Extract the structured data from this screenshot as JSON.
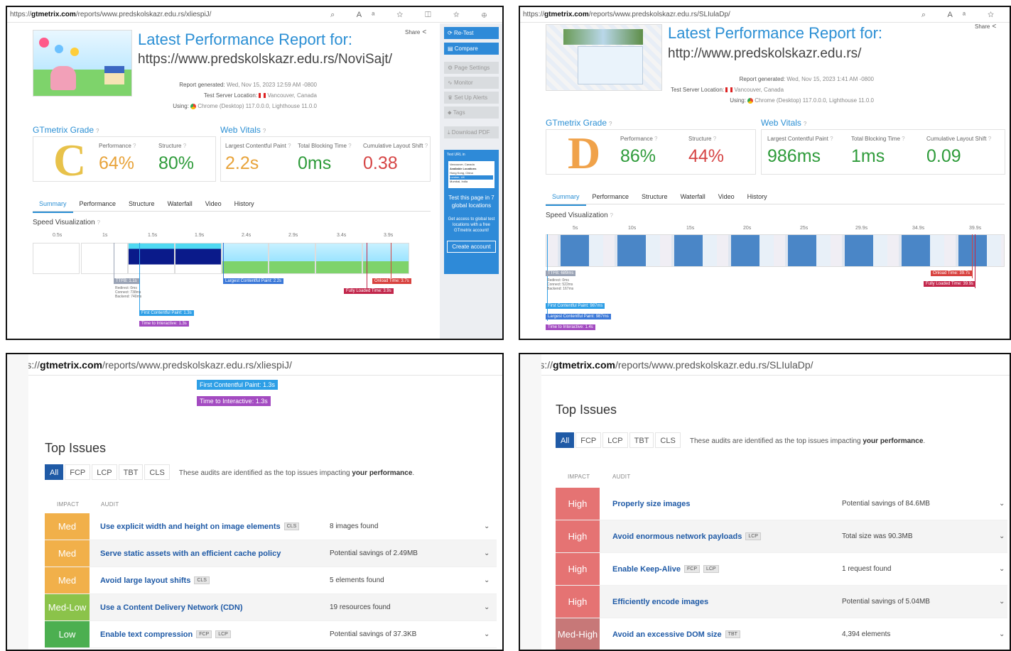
{
  "colors": {
    "accent": "#2b8fd4",
    "med": "#f1b04a",
    "medlow": "#8bc34a",
    "low": "#4caf50",
    "high": "#e57373",
    "medhigh": "#c77878"
  },
  "p1": {
    "url_prefix": "https://",
    "url_domain": "gtmetrix.com",
    "url_path": "/reports/www.predskolskazr.edu.rs/xliespiJ/",
    "title": "Latest Performance Report for:",
    "report_url": "https://www.predskolskazr.edu.rs/NoviSajt/",
    "share": "Share",
    "meta": {
      "generated_label": "Report generated:",
      "generated": "Wed, Nov 15, 2023 12:59 AM -0800",
      "location_label": "Test Server Location:",
      "location": "Vancouver, Canada",
      "using_label": "Using:",
      "using": "Chrome (Desktop) 117.0.0.0, Lighthouse 11.0.0"
    },
    "grade_label": "GTmetrix Grade",
    "vitals_label": "Web Vitals",
    "grade": "C",
    "performance_label": "Performance",
    "performance": "64%",
    "structure_label": "Structure",
    "structure": "80%",
    "lcp_label": "Largest Contentful Paint",
    "lcp": "2.2s",
    "tbt_label": "Total Blocking Time",
    "tbt": "0ms",
    "cls_label": "Cumulative Layout Shift",
    "cls": "0.38",
    "tabs": [
      "Summary",
      "Performance",
      "Structure",
      "Waterfall",
      "Video",
      "History"
    ],
    "speed_label": "Speed Visualization",
    "ticks": [
      "0.5s",
      "1s",
      "1.5s",
      "1.9s",
      "2.4s",
      "2.9s",
      "3.4s",
      "3.9s"
    ],
    "ttfb": "TTFB: 1.1s",
    "ttfb_sub": [
      "Redirect: 0ms",
      "Connect: 738ms",
      "Backend: 740ms"
    ],
    "lcp_tag": "Largest Contentful Paint: 2.2s",
    "onload_tag": "Onload Time: 3.7s",
    "fully_tag": "Fully Loaded Time: 3.9s",
    "fcp_tag": "First Contentful Paint: 1.3s",
    "tti_tag": "Time to Interactive: 1.3s",
    "sidebar": {
      "retest": "Re-Test",
      "compare": "Compare",
      "page_settings": "Page Settings",
      "monitor": "Monitor",
      "alerts": "Set Up Alerts",
      "tags": "Tags",
      "pdf": "Download PDF",
      "mini_title": "Test URL in",
      "mini_lines": [
        "Vancouver, Canada",
        "Available Locations",
        "Hong Kong, China",
        "London, UK",
        "Mumbai, India"
      ],
      "promo1": "Test this page in 7 global locations",
      "promo2": "Get access to global test locations with a free GTmetrix account!",
      "create": "Create account"
    }
  },
  "p2": {
    "url_prefix": "https://",
    "url_domain": "gtmetrix.com",
    "url_path": "/reports/www.predskolskazr.edu.rs/SLIulaDp/",
    "title": "Latest Performance Report for:",
    "report_url": "http://www.predskolskazr.edu.rs/",
    "share": "Share",
    "meta": {
      "generated_label": "Report generated:",
      "generated": "Wed, Nov 15, 2023 1:41 AM -0800",
      "location_label": "Test Server Location:",
      "location": "Vancouver, Canada",
      "using_label": "Using:",
      "using": "Chrome (Desktop) 117.0.0.0, Lighthouse 11.0.0"
    },
    "grade_label": "GTmetrix Grade",
    "vitals_label": "Web Vitals",
    "grade": "D",
    "performance_label": "Performance",
    "performance": "86%",
    "structure_label": "Structure",
    "structure": "44%",
    "lcp_label": "Largest Contentful Paint",
    "lcp": "986ms",
    "tbt_label": "Total Blocking Time",
    "tbt": "1ms",
    "cls_label": "Cumulative Layout Shift",
    "cls": "0.09",
    "tabs": [
      "Summary",
      "Performance",
      "Structure",
      "Waterfall",
      "Video",
      "History"
    ],
    "speed_label": "Speed Visualization",
    "ticks": [
      "5s",
      "10s",
      "15s",
      "20s",
      "25s",
      "29.9s",
      "34.9s",
      "39.9s"
    ],
    "ttfb": "TTFB: 689ms",
    "ttfb_sub": [
      "Redirect: 0ms",
      "Connect: 522ms",
      "Backend: 167ms"
    ],
    "onload_tag": "Onload Time: 39.7s",
    "fully_tag": "Fully Loaded Time: 39.9s",
    "fcp_tag": "First Contentful Paint: 987ms",
    "lcp_tag": "Largest Contentful Paint: 987ms",
    "tti_tag": "Time to Interactive: 1.4s"
  },
  "p3": {
    "url_prefix": "https://",
    "url_domain": "gtmetrix.com",
    "url_path": "/reports/www.predskolskazr.edu.rs/xliespiJ/",
    "fcp_tag": "First Contentful Paint: 1.3s",
    "tti_tag": "Time to Interactive: 1.3s",
    "title": "Top Issues",
    "filters": [
      "All",
      "FCP",
      "LCP",
      "TBT",
      "CLS"
    ],
    "desc": "These audits are identified as the top issues impacting",
    "desc_bold": "your performance",
    "impact_h": "IMPACT",
    "audit_h": "AUDIT",
    "rows": [
      {
        "impact": "Med",
        "audit": "Use explicit width and height on image elements",
        "chips": [
          "CLS"
        ],
        "result": "8 images found"
      },
      {
        "impact": "Med",
        "audit": "Serve static assets with an efficient cache policy",
        "chips": [],
        "result": "Potential savings of 2.49MB"
      },
      {
        "impact": "Med",
        "audit": "Avoid large layout shifts",
        "chips": [
          "CLS"
        ],
        "result": "5 elements found"
      },
      {
        "impact": "Med-Low",
        "audit": "Use a Content Delivery Network (CDN)",
        "chips": [],
        "result": "19 resources found"
      },
      {
        "impact": "Low",
        "audit": "Enable text compression",
        "chips": [
          "FCP",
          "LCP"
        ],
        "result": "Potential savings of 37.3KB"
      }
    ]
  },
  "p4": {
    "url_prefix": "https://",
    "url_domain": "gtmetrix.com",
    "url_path": "/reports/www.predskolskazr.edu.rs/SLIulaDp/",
    "title": "Top Issues",
    "filters": [
      "All",
      "FCP",
      "LCP",
      "TBT",
      "CLS"
    ],
    "desc": "These audits are identified as the top issues impacting",
    "desc_bold": "your performance",
    "impact_h": "IMPACT",
    "audit_h": "AUDIT",
    "rows": [
      {
        "impact": "High",
        "audit": "Properly size images",
        "chips": [],
        "result": "Potential savings of 84.6MB"
      },
      {
        "impact": "High",
        "audit": "Avoid enormous network payloads",
        "chips": [
          "LCP"
        ],
        "result": "Total size was 90.3MB"
      },
      {
        "impact": "High",
        "audit": "Enable Keep-Alive",
        "chips": [
          "FCP",
          "LCP"
        ],
        "result": "1 request found"
      },
      {
        "impact": "High",
        "audit": "Efficiently encode images",
        "chips": [],
        "result": "Potential savings of 5.04MB"
      },
      {
        "impact": "Med-High",
        "audit": "Avoid an excessive DOM size",
        "chips": [
          "TBT"
        ],
        "result": "4,394 elements"
      }
    ]
  }
}
